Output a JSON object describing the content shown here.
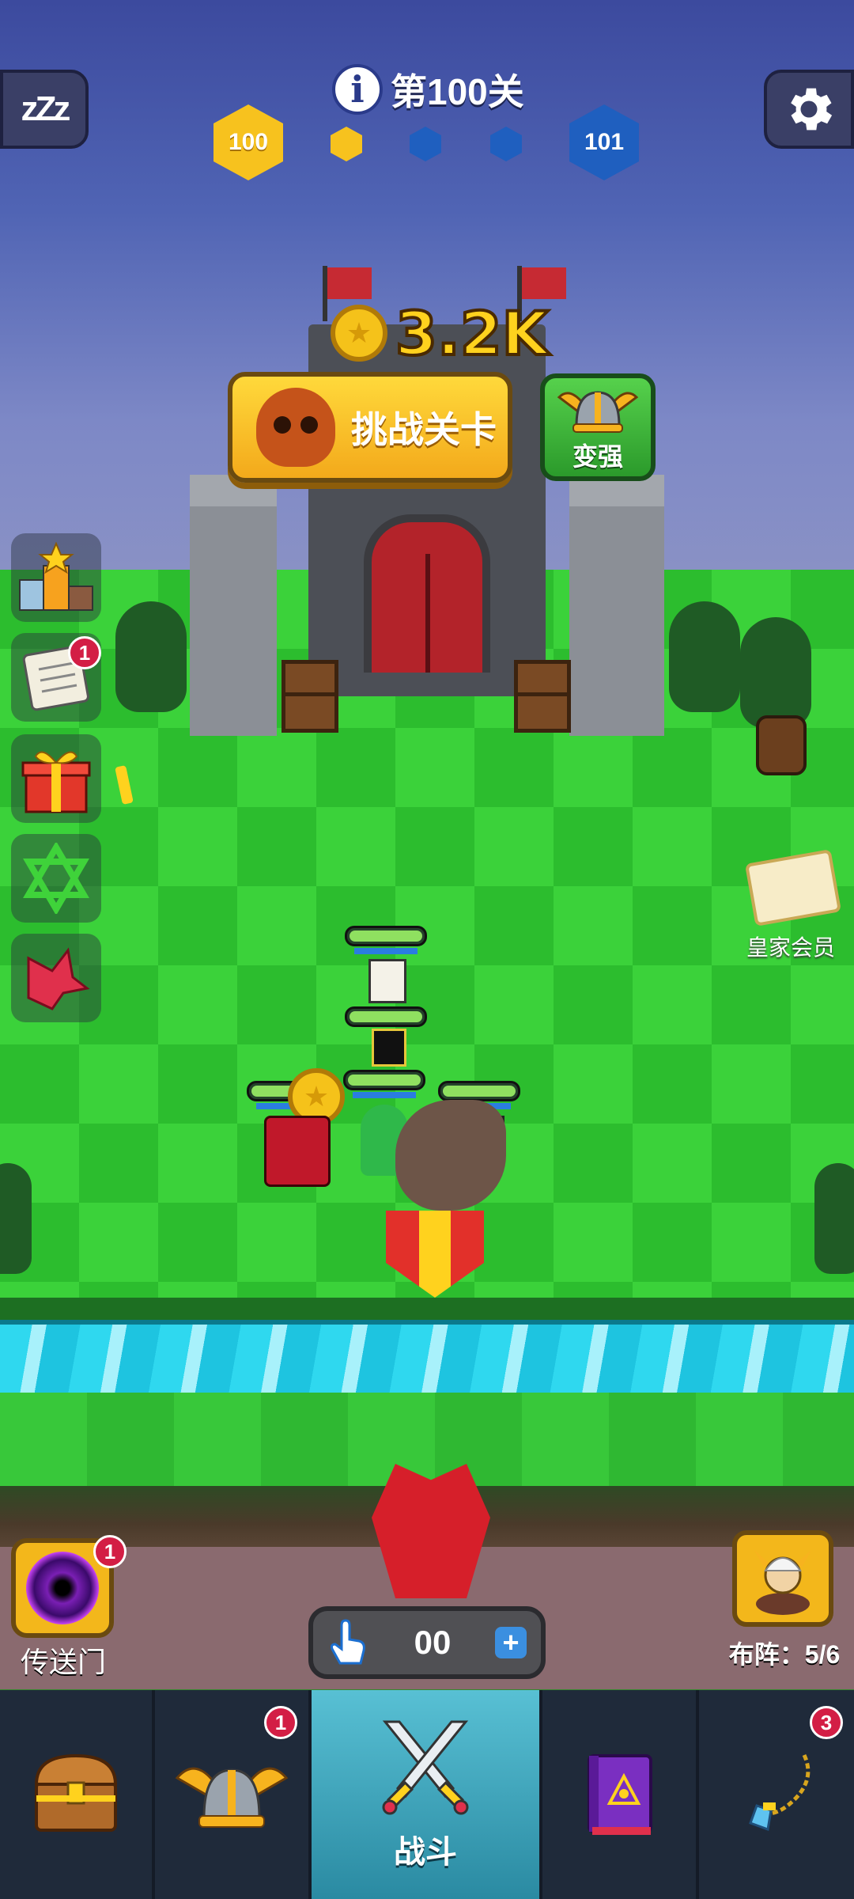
{
  "hud": {
    "level_label": "第100关",
    "current_level": "100",
    "next_level": "101",
    "progress_steps": 3,
    "progress_completed": 1
  },
  "reward": {
    "amount": "3.2K"
  },
  "actions": {
    "challenge_label": "挑战关卡",
    "power_up_label": "变强"
  },
  "side_menu": [
    {
      "name": "leaderboard",
      "badge": ""
    },
    {
      "name": "quest-scroll",
      "badge": "1"
    },
    {
      "name": "gift",
      "badge": ""
    },
    {
      "name": "hexagram",
      "badge": ""
    },
    {
      "name": "red-crystal",
      "badge": ""
    }
  ],
  "royal": {
    "label": "皇家会员"
  },
  "portal": {
    "label": "传送门",
    "badge": "1"
  },
  "formation": {
    "label": "布阵：",
    "count": "5/6"
  },
  "counter": {
    "value": "00"
  },
  "nav": {
    "items": [
      {
        "id": "chest",
        "label": "",
        "badge": ""
      },
      {
        "id": "helmet",
        "label": "",
        "badge": "1"
      },
      {
        "id": "battle",
        "label": "战斗",
        "badge": ""
      },
      {
        "id": "spellbook",
        "label": "",
        "badge": ""
      },
      {
        "id": "necklace",
        "label": "",
        "badge": "3"
      }
    ]
  },
  "colors": {
    "gold": "#f7c21e",
    "blue_hex": "#1f5fbf",
    "badge_red": "#d31e45",
    "active_tab": "#58c0d4",
    "nav_bg": "#1f2a3a"
  }
}
